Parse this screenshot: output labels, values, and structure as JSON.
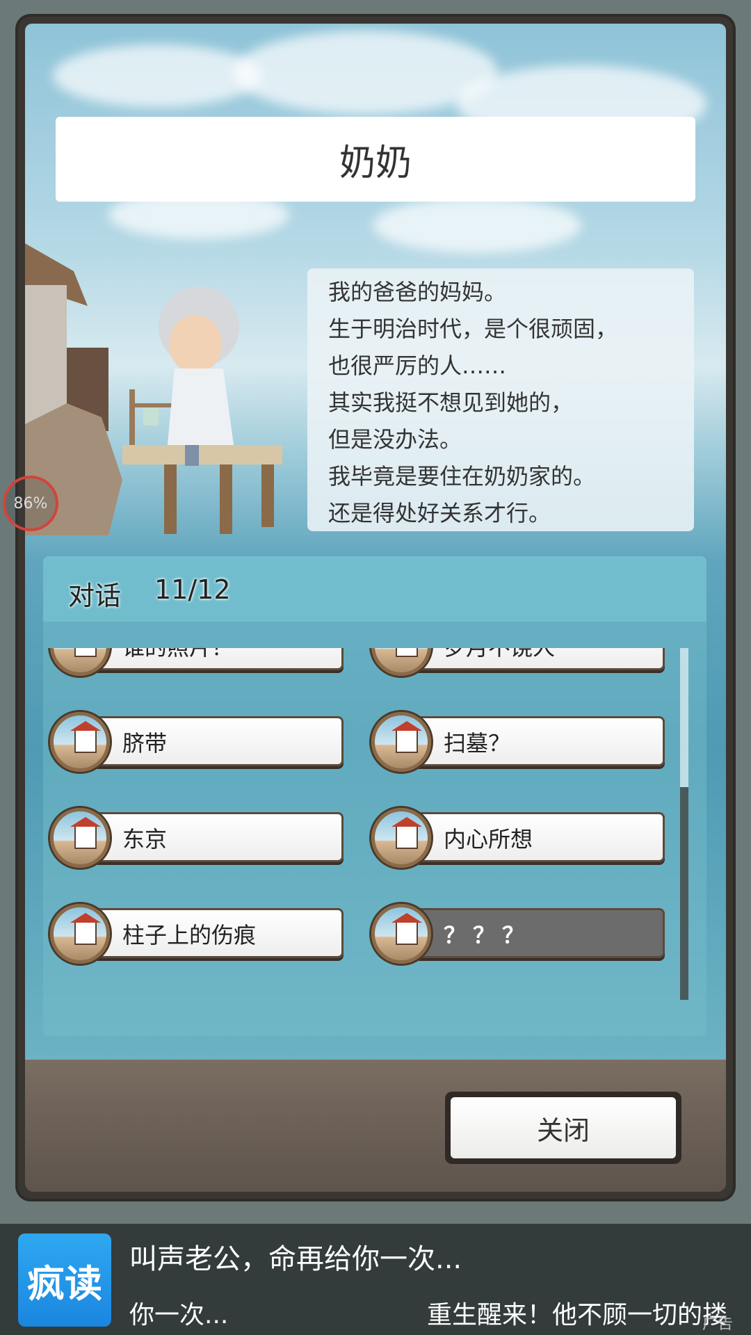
{
  "character": {
    "name": "奶奶",
    "description_lines": [
      "我的爸爸的妈妈。",
      "生于明治时代，是个很顽固，",
      "也很严厉的人……",
      "其实我挺不想见到她的，",
      "但是没办法。",
      "我毕竟是要住在奶奶家的。",
      "还是得处好关系才行。"
    ]
  },
  "progress": {
    "label": "86%",
    "value": 86
  },
  "dialog": {
    "title": "对话",
    "count": "11/12",
    "options": [
      {
        "label": "谁的照片？",
        "locked": false
      },
      {
        "label": "岁月不饶人",
        "locked": false
      },
      {
        "label": "脐带",
        "locked": false
      },
      {
        "label": "扫墓？",
        "locked": false
      },
      {
        "label": "东京",
        "locked": false
      },
      {
        "label": "内心所想",
        "locked": false
      },
      {
        "label": "柱子上的伤痕",
        "locked": false
      },
      {
        "label": "？？？",
        "locked": true
      }
    ]
  },
  "close_button": {
    "label": "关闭"
  },
  "ad": {
    "logo_text": "疯读",
    "title": "叫声老公，命再给你一次...",
    "sub_left": "你一次...",
    "sub_right": "重生醒来！他不顾一切的搂",
    "tag": "广告"
  },
  "colors": {
    "title_bg": "#ffffff",
    "locked_option": "#6c6c6c",
    "progress_ring": "#d2443c"
  }
}
